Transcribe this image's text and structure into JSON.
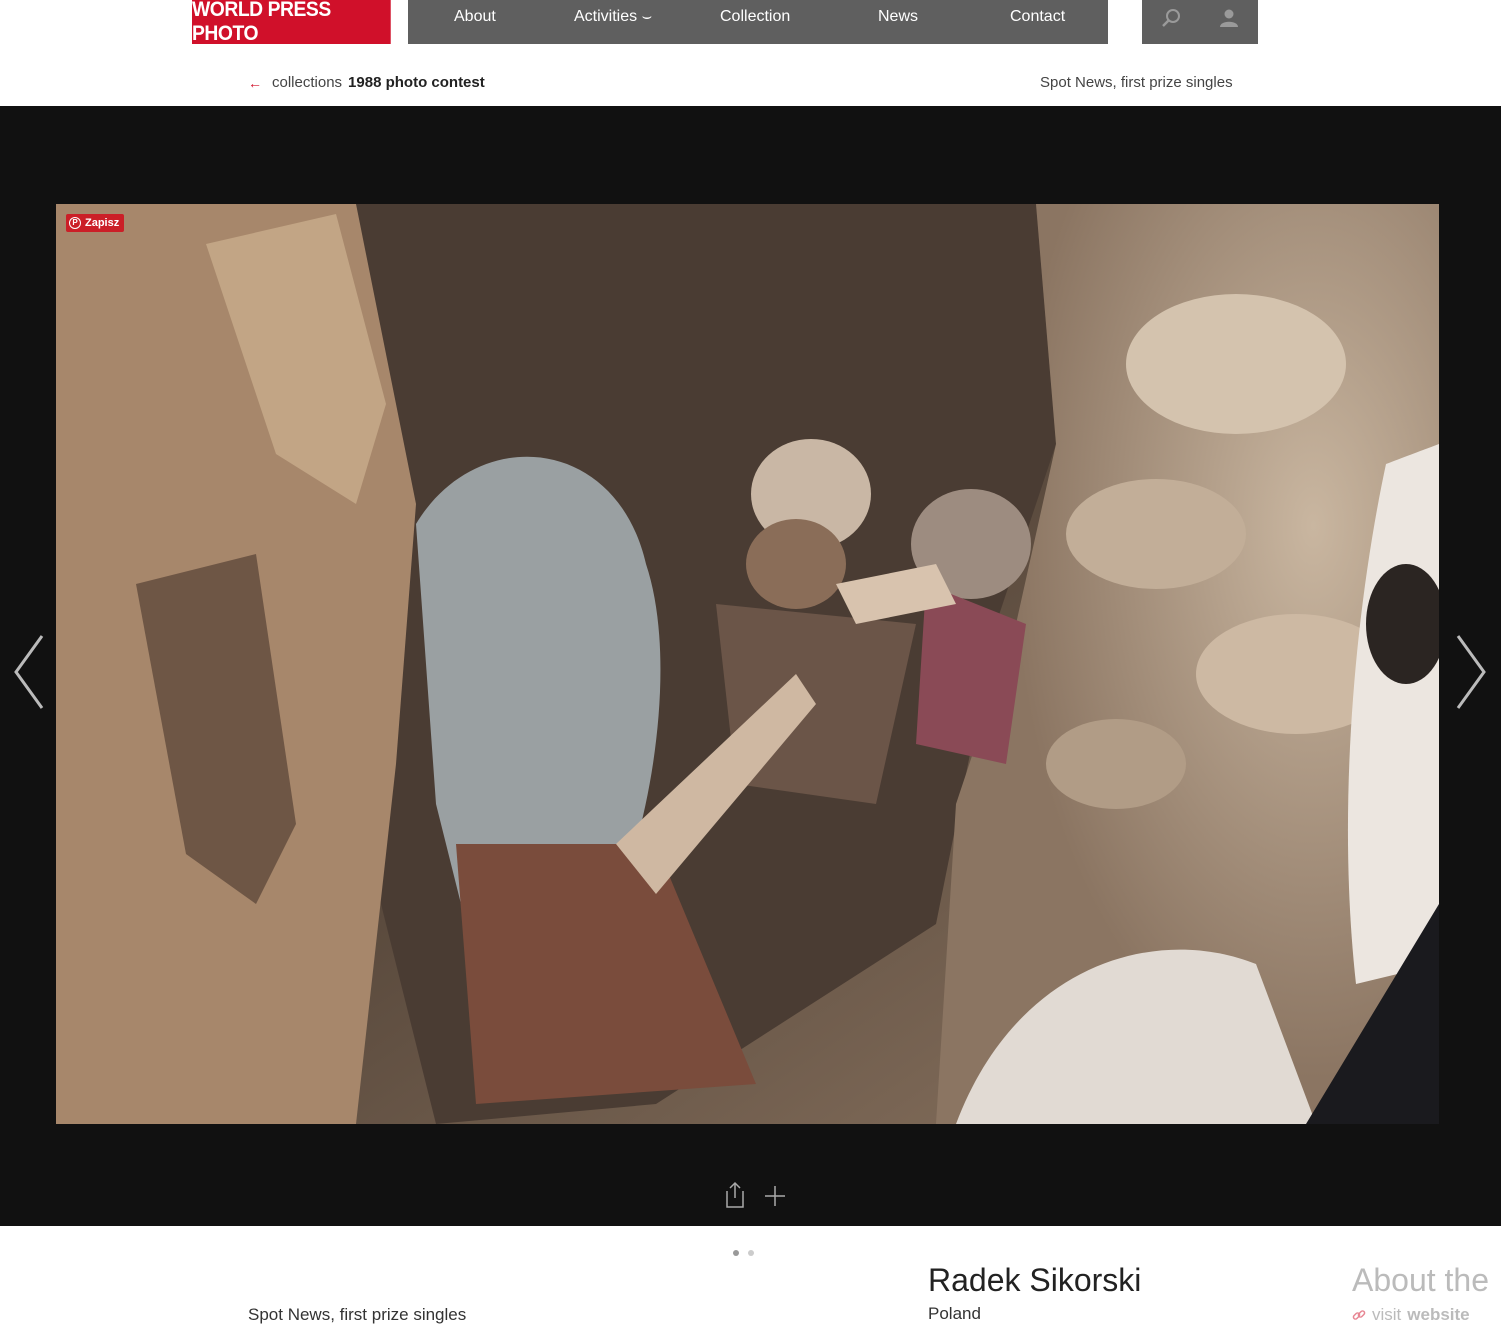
{
  "header": {
    "logo": "WORLD PRESS PHOTO",
    "nav": [
      {
        "label": "About"
      },
      {
        "label": "Activities ⌣"
      },
      {
        "label": "Collection"
      },
      {
        "label": "News"
      },
      {
        "label": "Contact"
      }
    ],
    "tools": {
      "search_icon": "search-icon",
      "user_icon": "user-icon"
    }
  },
  "breadcrumb": {
    "root": "collections",
    "current": "1988 photo contest",
    "category": "Spot News, first prize singles"
  },
  "viewer": {
    "pin_label": "Zapisz",
    "prev_icon": "chevron-left-icon",
    "next_icon": "chevron-right-icon",
    "actions": [
      "share-icon",
      "plus-icon"
    ]
  },
  "pagination": {
    "count": 2,
    "active_index": 0
  },
  "caption": {
    "category": "Spot News, first prize singles",
    "photographer": "Radek Sikorski",
    "country": "Poland",
    "about_heading": "About the",
    "visit_prefix": "visit",
    "visit_link": "website"
  },
  "colors": {
    "brand": "#d0102a",
    "nav_bg": "#5f5f5f",
    "stage_bg": "#111111"
  }
}
